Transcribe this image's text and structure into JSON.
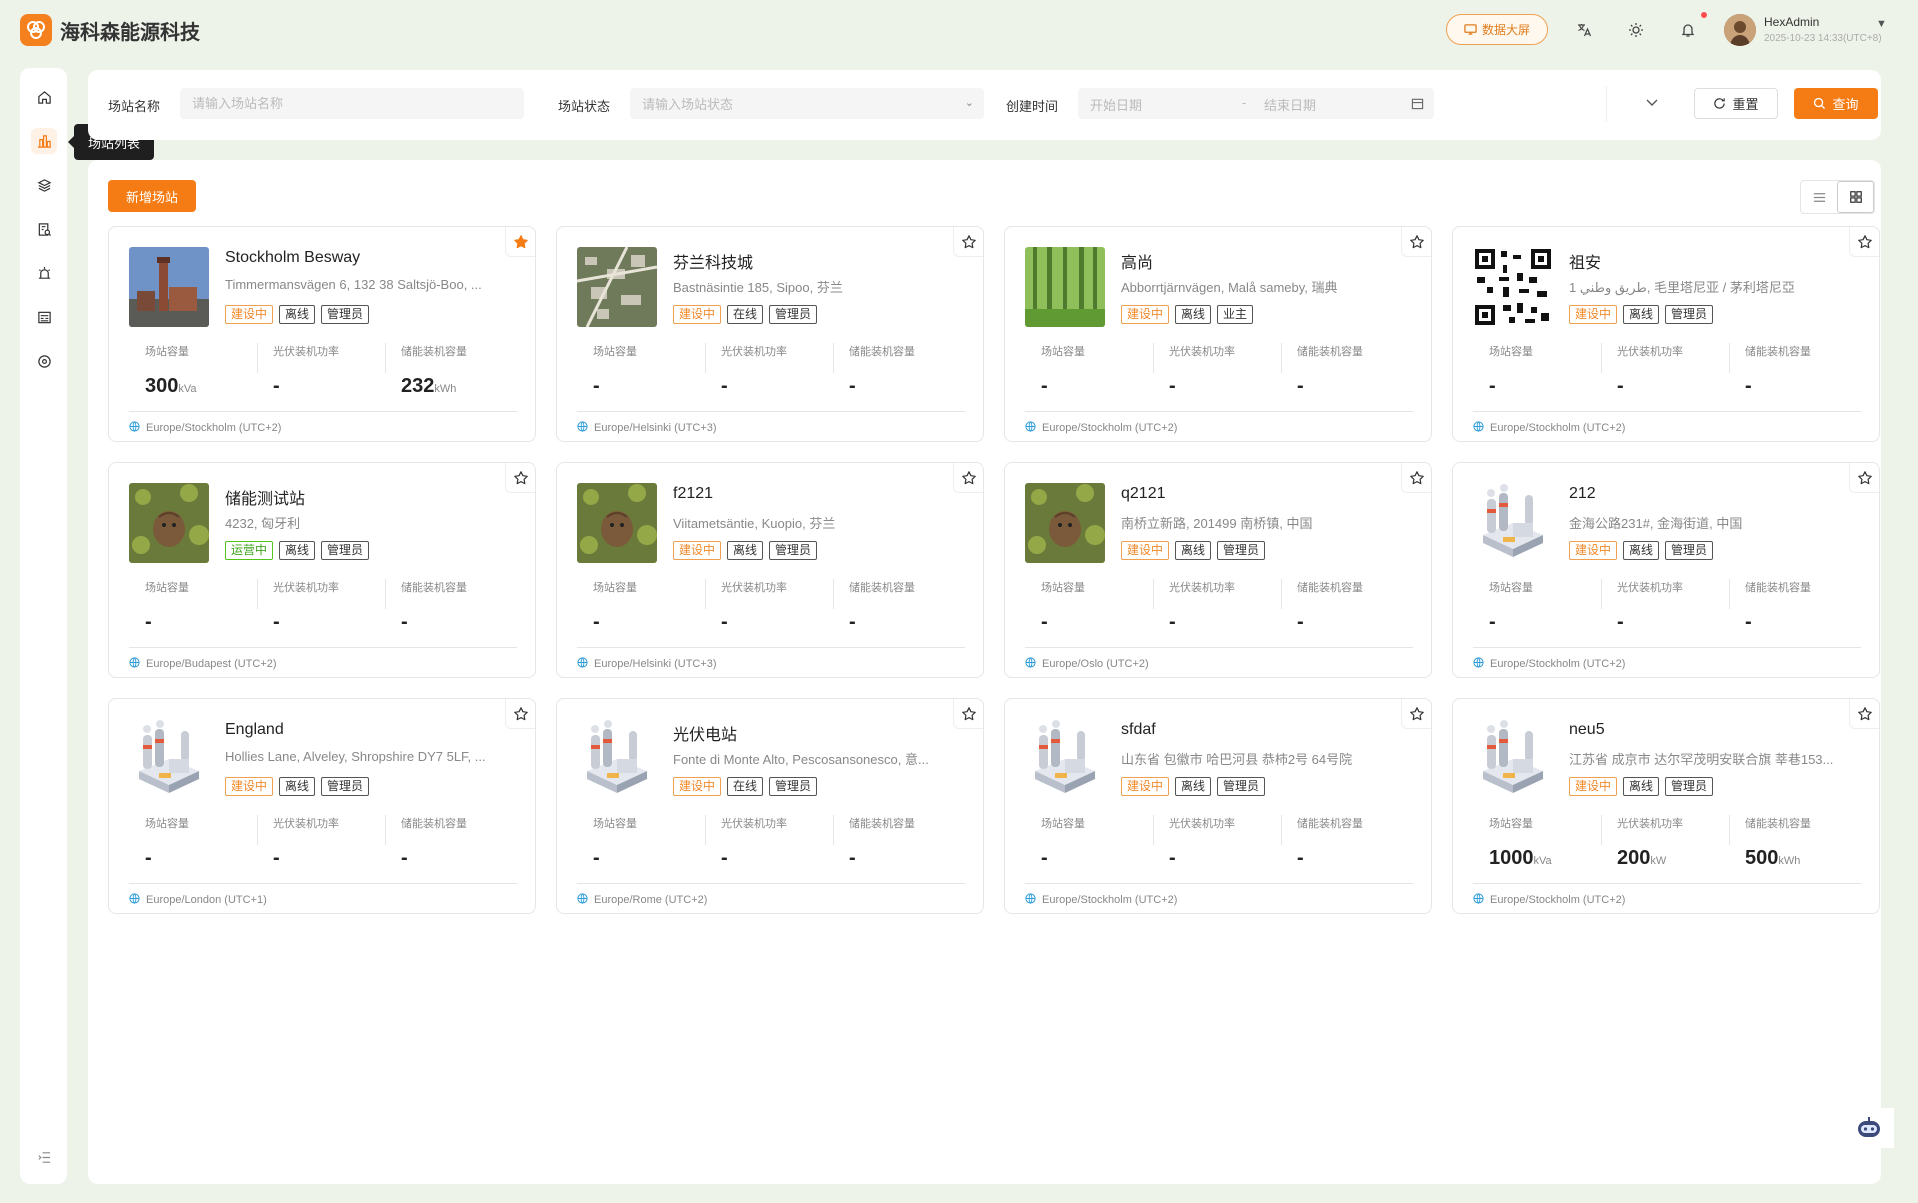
{
  "header": {
    "brand": "海科森能源科技",
    "dashboard_label": "数据大屏",
    "user_name": "HexAdmin",
    "user_time": "2025-10-23 14:33(UTC+8)"
  },
  "sidebar": {
    "tooltip": "场站列表",
    "items": [
      "home-icon",
      "station-list-icon",
      "layers-icon",
      "report-icon",
      "alarm-icon",
      "bill-icon",
      "settings-icon"
    ]
  },
  "filter": {
    "station_name_label": "场站名称",
    "station_name_placeholder": "请输入场站名称",
    "station_status_label": "场站状态",
    "station_status_placeholder": "请输入场站状态",
    "created_label": "创建时间",
    "start_placeholder": "开始日期",
    "range_sep": "-",
    "end_placeholder": "结束日期",
    "reset_label": "重置",
    "query_label": "查询"
  },
  "main": {
    "add_label": "新增场站"
  },
  "metric_labels": {
    "capacity": "场站容量",
    "pv_power": "光伏装机功率",
    "storage": "储能装机容量"
  },
  "stations": [
    {
      "title": "Stockholm Besway",
      "addr": "Timmermansvägen 6, 132 38 Saltsjö-Boo, ...",
      "tags": [
        {
          "t": "建设中",
          "c": "orange"
        },
        {
          "t": "离线",
          "c": "plain"
        },
        {
          "t": "管理员",
          "c": "plain"
        }
      ],
      "cap": "300",
      "cap_unit": "kVa",
      "pv": "-",
      "pv_unit": "",
      "st": "232",
      "st_unit": "kWh",
      "tz": "Europe/Stockholm (UTC+2)",
      "fav": true,
      "img": "city"
    },
    {
      "title": "芬兰科技城",
      "addr": "Bastnäsintie 185, Sipoo, 芬兰",
      "tags": [
        {
          "t": "建设中",
          "c": "orange"
        },
        {
          "t": "在线",
          "c": "plain"
        },
        {
          "t": "管理员",
          "c": "plain"
        }
      ],
      "cap": "-",
      "cap_unit": "",
      "pv": "-",
      "pv_unit": "",
      "st": "-",
      "st_unit": "",
      "tz": "Europe/Helsinki (UTC+3)",
      "fav": false,
      "img": "aerial"
    },
    {
      "title": "高尚",
      "addr": "Abborrtjärnvägen, Malå sameby, 瑞典",
      "tags": [
        {
          "t": "建设中",
          "c": "orange"
        },
        {
          "t": "离线",
          "c": "plain"
        },
        {
          "t": "业主",
          "c": "plain"
        }
      ],
      "cap": "-",
      "cap_unit": "",
      "pv": "-",
      "pv_unit": "",
      "st": "-",
      "st_unit": "",
      "tz": "Europe/Stockholm (UTC+2)",
      "fav": false,
      "img": "forest"
    },
    {
      "title": "祖安",
      "addr": "1 طريق وطني, 毛里塔尼亚 / 茅利塔尼亞",
      "tags": [
        {
          "t": "建设中",
          "c": "orange"
        },
        {
          "t": "离线",
          "c": "plain"
        },
        {
          "t": "管理员",
          "c": "plain"
        }
      ],
      "cap": "-",
      "cap_unit": "",
      "pv": "-",
      "pv_unit": "",
      "st": "-",
      "st_unit": "",
      "tz": "Europe/Stockholm (UTC+2)",
      "fav": false,
      "img": "qr"
    },
    {
      "title": "储能测试站",
      "addr": "4232, 匈牙利",
      "tags": [
        {
          "t": "运营中",
          "c": "green"
        },
        {
          "t": "离线",
          "c": "plain"
        },
        {
          "t": "管理员",
          "c": "plain"
        }
      ],
      "cap": "-",
      "cap_unit": "",
      "pv": "-",
      "pv_unit": "",
      "st": "-",
      "st_unit": "",
      "tz": "Europe/Budapest (UTC+2)",
      "fav": false,
      "img": "moss"
    },
    {
      "title": "f2121",
      "addr": "Viitametsäntie, Kuopio, 芬兰",
      "tags": [
        {
          "t": "建设中",
          "c": "orange"
        },
        {
          "t": "离线",
          "c": "plain"
        },
        {
          "t": "管理员",
          "c": "plain"
        }
      ],
      "cap": "-",
      "cap_unit": "",
      "pv": "-",
      "pv_unit": "",
      "st": "-",
      "st_unit": "",
      "tz": "Europe/Helsinki (UTC+3)",
      "fav": false,
      "img": "moss"
    },
    {
      "title": "q2121",
      "addr": "南桥立新路, 201499 南桥镇, 中国",
      "tags": [
        {
          "t": "建设中",
          "c": "orange"
        },
        {
          "t": "离线",
          "c": "plain"
        },
        {
          "t": "管理员",
          "c": "plain"
        }
      ],
      "cap": "-",
      "cap_unit": "",
      "pv": "-",
      "pv_unit": "",
      "st": "-",
      "st_unit": "",
      "tz": "Europe/Oslo (UTC+2)",
      "fav": false,
      "img": "moss"
    },
    {
      "title": "212",
      "addr": "金海公路231#, 金海街道, 中国",
      "tags": [
        {
          "t": "建设中",
          "c": "orange"
        },
        {
          "t": "离线",
          "c": "plain"
        },
        {
          "t": "管理员",
          "c": "plain"
        }
      ],
      "cap": "-",
      "cap_unit": "",
      "pv": "-",
      "pv_unit": "",
      "st": "-",
      "st_unit": "",
      "tz": "Europe/Stockholm (UTC+2)",
      "fav": false,
      "img": "plant"
    },
    {
      "title": "England",
      "addr": "Hollies Lane, Alveley, Shropshire DY7 5LF, ...",
      "tags": [
        {
          "t": "建设中",
          "c": "orange"
        },
        {
          "t": "离线",
          "c": "plain"
        },
        {
          "t": "管理员",
          "c": "plain"
        }
      ],
      "cap": "-",
      "cap_unit": "",
      "pv": "-",
      "pv_unit": "",
      "st": "-",
      "st_unit": "",
      "tz": "Europe/London (UTC+1)",
      "fav": false,
      "img": "plant"
    },
    {
      "title": "光伏电站",
      "addr": "Fonte di Monte Alto, Pescosansonesco, 意...",
      "tags": [
        {
          "t": "建设中",
          "c": "orange"
        },
        {
          "t": "在线",
          "c": "plain"
        },
        {
          "t": "管理员",
          "c": "plain"
        }
      ],
      "cap": "-",
      "cap_unit": "",
      "pv": "-",
      "pv_unit": "",
      "st": "-",
      "st_unit": "",
      "tz": "Europe/Rome (UTC+2)",
      "fav": false,
      "img": "plant"
    },
    {
      "title": "sfdaf",
      "addr": "山东省 包徽市 哈巴河县 恭柿2号 64号院",
      "tags": [
        {
          "t": "建设中",
          "c": "orange"
        },
        {
          "t": "离线",
          "c": "plain"
        },
        {
          "t": "管理员",
          "c": "plain"
        }
      ],
      "cap": "-",
      "cap_unit": "",
      "pv": "-",
      "pv_unit": "",
      "st": "-",
      "st_unit": "",
      "tz": "Europe/Stockholm (UTC+2)",
      "fav": false,
      "img": "plant"
    },
    {
      "title": "neu5",
      "addr": "江苏省 成京市 达尔罕茂明安联合旗 莘巷153...",
      "tags": [
        {
          "t": "建设中",
          "c": "orange"
        },
        {
          "t": "离线",
          "c": "plain"
        },
        {
          "t": "管理员",
          "c": "plain"
        }
      ],
      "cap": "1000",
      "cap_unit": "kVa",
      "pv": "200",
      "pv_unit": "kW",
      "st": "500",
      "st_unit": "kWh",
      "tz": "Europe/Stockholm (UTC+2)",
      "fav": false,
      "img": "plant"
    }
  ]
}
